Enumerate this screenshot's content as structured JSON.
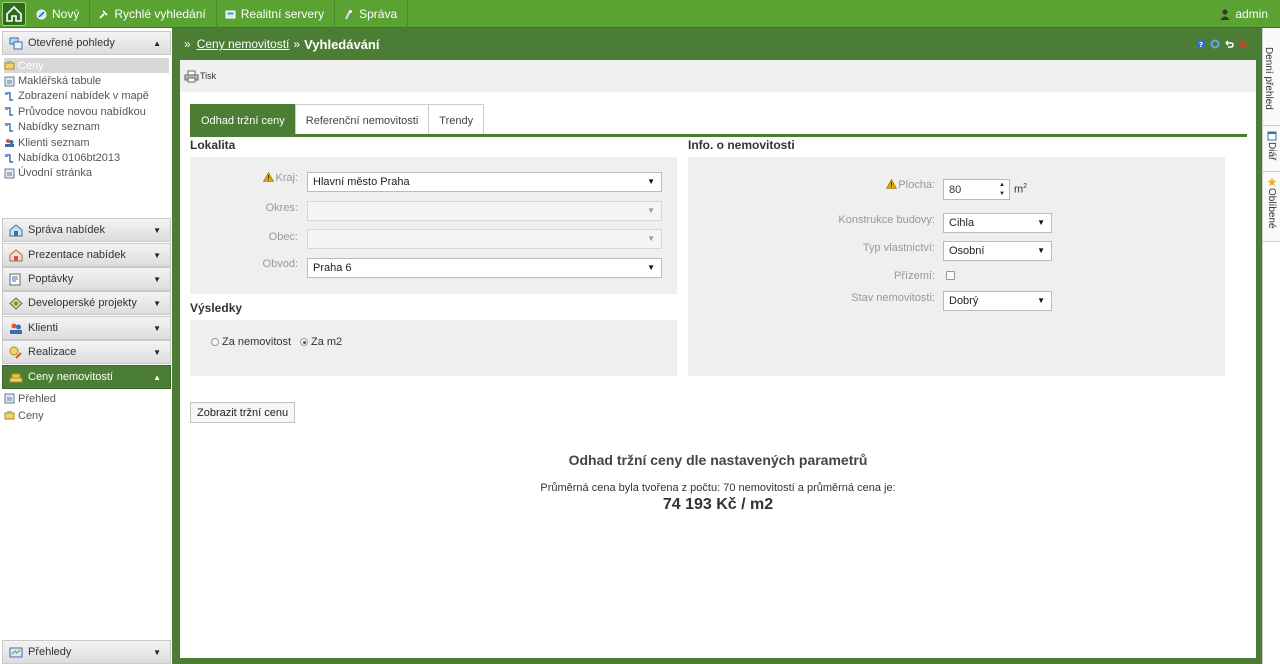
{
  "topbar": {
    "menu": [
      {
        "label": "Nový",
        "icon": "new-icon"
      },
      {
        "label": "Rychlé vyhledání",
        "icon": "quick-search-icon"
      },
      {
        "label": "Realitní servery",
        "icon": "servers-icon"
      },
      {
        "label": "Správa",
        "icon": "admin-tools-icon"
      }
    ],
    "user": "admin"
  },
  "sidebar": {
    "open_views": {
      "title": "Otevřené pohledy",
      "items": [
        "Ceny",
        "Makléřská tabule",
        "Zobrazení nabídek v mapě",
        "Průvodce novou nabídkou",
        "Nabídky seznam",
        "Klienti seznam",
        "Nabídka 0106bt2013",
        "Úvodní stránka"
      ]
    },
    "sections": [
      "Správa nabídek",
      "Prezentace nabídek",
      "Poptávky",
      "Developerské projekty",
      "Klienti",
      "Realizace"
    ],
    "active_section": {
      "title": "Ceny nemovitostí",
      "items": [
        "Přehled",
        "Ceny"
      ]
    },
    "bottom_section": "Přehledy"
  },
  "header": {
    "breadcrumb_prefix": "»",
    "breadcrumb_link": "Ceny nemovitostí",
    "breadcrumb_sep": "»",
    "breadcrumb_current": "Vyhledávání"
  },
  "toolbar": {
    "print_label": "Tisk"
  },
  "tabs": [
    "Odhad tržní ceny",
    "Referenční nemovitosti",
    "Trendy"
  ],
  "locality": {
    "title": "Lokalita",
    "kraj_label": "Kraj:",
    "kraj_value": "Hlavní město Praha",
    "okres_label": "Okres:",
    "okres_value": "",
    "obec_label": "Obec:",
    "obec_value": "",
    "obvod_label": "Obvod:",
    "obvod_value": "Praha 6"
  },
  "results": {
    "title": "Výsledky",
    "option_1": "Za nemovitost",
    "option_2": "Za m2",
    "selected": "Za m2"
  },
  "property": {
    "title": "Info. o nemovitosti",
    "plocha_label": "Plocha:",
    "plocha_value": "80",
    "plocha_unit": "m",
    "plocha_unit_sup": "2",
    "konstrukce_label": "Konstrukce budovy:",
    "konstrukce_value": "Cihla",
    "vlastnictvi_label": "Typ vlastnictví:",
    "vlastnictvi_value": "Osobní",
    "prizemi_label": "Přízemí:",
    "stav_label": "Stav nemovitosti:",
    "stav_value": "Dobrý"
  },
  "actions": {
    "show_price": "Zobrazit tržní cenu"
  },
  "estimate": {
    "title": "Odhad tržní ceny dle nastavených parametrů",
    "text": "Průměrná cena byla tvořena z počtu: 70 nemovitostí a průměrná cena je:",
    "value": "74 193 Kč / m2"
  },
  "right_strip": [
    "Denní přehled",
    "Diář",
    "Oblíbené"
  ],
  "colors": {
    "brand_green": "#5aa332",
    "dark_green": "#4b7d35",
    "warning": "#e0a800"
  }
}
